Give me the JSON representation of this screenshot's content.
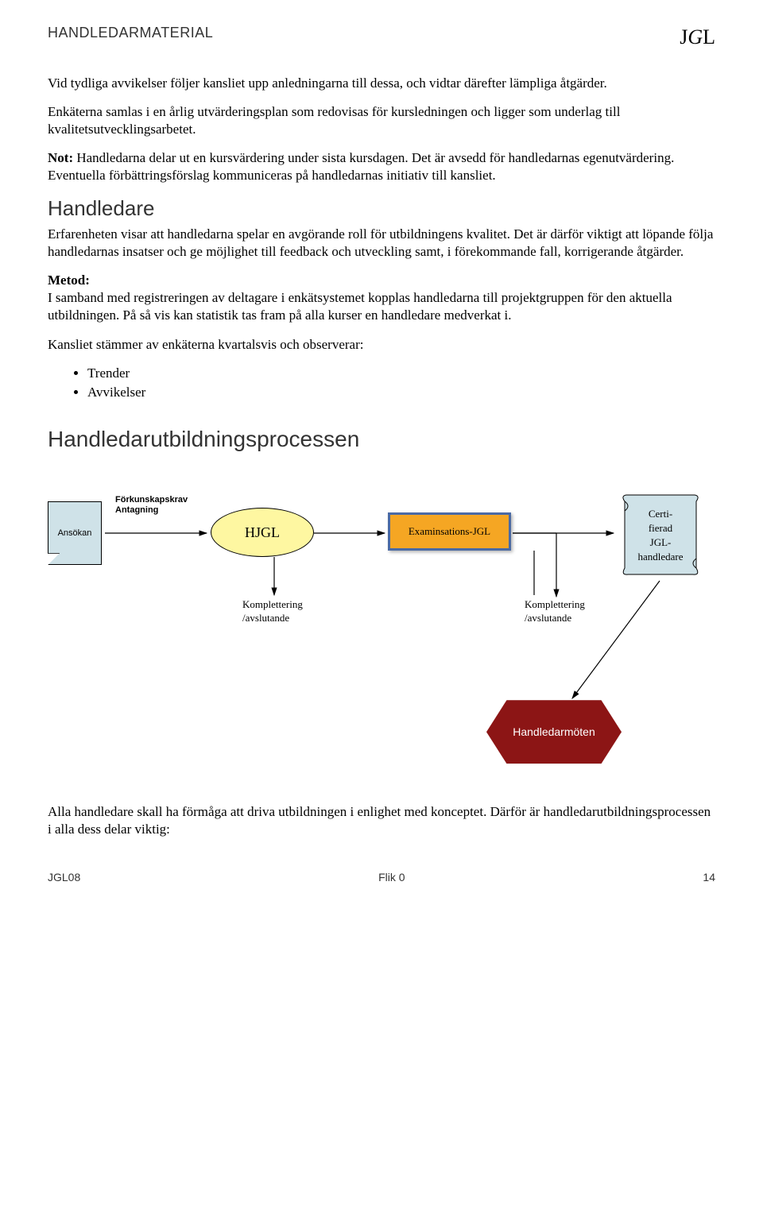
{
  "header": {
    "title": "HANDLEDARMATERIAL",
    "logo_left": "J",
    "logo_mid": "G",
    "logo_right": "L"
  },
  "p1": "Vid tydliga avvikelser följer kansliet upp anledningarna till dessa, och vidtar därefter lämpliga åtgärder.",
  "p2": "Enkäterna samlas i en årlig utvärderingsplan som redovisas för kursledningen och ligger som underlag till kvalitetsutvecklingsarbetet.",
  "p3a": "Not:",
  "p3b": " Handledarna delar ut en kursvärdering under sista kursdagen. Det är avsedd för handledarnas egenutvärdering. Eventuella förbättringsförslag kommuniceras på handledarnas initiativ till kansliet.",
  "s1_title": "Handledare",
  "p4": "Erfarenheten visar att handledarna spelar en avgörande roll för utbildningens kvalitet. Det är därför viktigt att löpande följa handledarnas insatser och ge möjlighet till feedback och utveckling samt, i förekommande fall, korrigerande åtgärder.",
  "p5a": "Metod:",
  "p5b": "I samband med registreringen av deltagare i enkätsystemet kopplas handledarna till projektgruppen för den aktuella utbildningen. På så vis kan statistik tas fram på alla kurser en handledare medverkat i.",
  "p6": "Kansliet stämmer av enkäterna kvartalsvis och observerar:",
  "bullets": [
    "Trender",
    "Avvikelser"
  ],
  "s2_title": "Handledarutbildningsprocessen",
  "diagram": {
    "ansokan": "Ansökan",
    "arrow1_label": "Förkunskapskrav\nAntagning",
    "hjgl": "HJGL",
    "exam": "Examinsations-JGL",
    "cert": "Certi-\nfierad\nJGL-\nhandledare",
    "komp1": "Komplettering\n/avslutande",
    "komp2": "Komplettering\n/avslutande",
    "hex": "Handledarmöten"
  },
  "p7": "Alla handledare skall ha förmåga att driva utbildningen i enlighet med konceptet. Därför är handledarutbildningsprocessen i alla dess delar viktig:",
  "footer": {
    "left": "JGL08",
    "center": "Flik 0",
    "right": "14"
  }
}
